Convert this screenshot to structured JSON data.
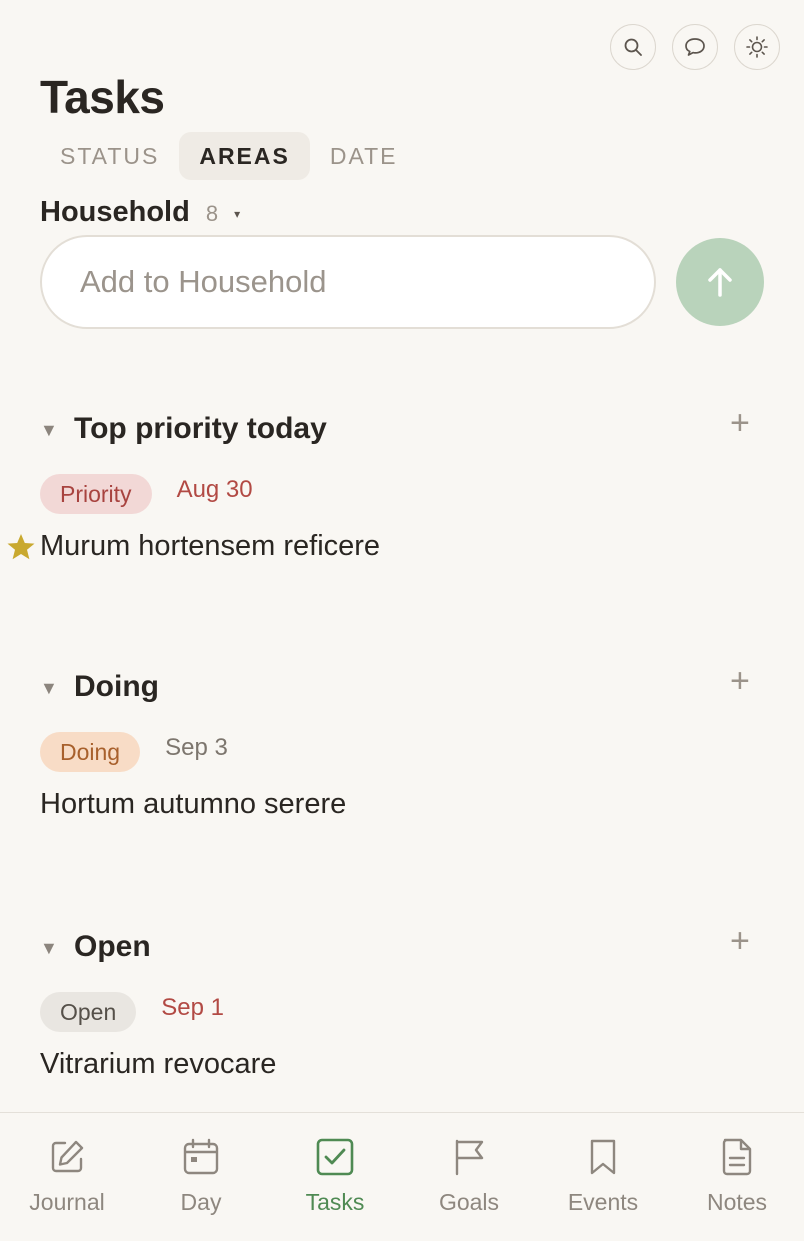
{
  "header": {
    "title": "Tasks",
    "icons": [
      "search-icon",
      "chat-icon",
      "brightness-icon"
    ]
  },
  "tabs": [
    {
      "label": "STATUS",
      "active": false
    },
    {
      "label": "AREAS",
      "active": true
    },
    {
      "label": "DATE",
      "active": false
    }
  ],
  "area": {
    "name": "Household",
    "count": "8",
    "caret": "▾"
  },
  "add_input": {
    "placeholder": "Add to Household",
    "value": ""
  },
  "sections": [
    {
      "title": "Top priority today",
      "caret": "▼",
      "add": "+",
      "task": {
        "badge": "Priority",
        "due": "Aug 30",
        "due_color": "#b24a44",
        "title": "Murum hortensem reficere",
        "starred": true
      }
    },
    {
      "title": "Doing",
      "caret": "▼",
      "add": "+",
      "task": {
        "badge": "Doing",
        "due": "Sep 3",
        "due_color": "#7d766e",
        "title": "Hortum autumno serere",
        "starred": false
      }
    },
    {
      "title": "Open",
      "caret": "▼",
      "add": "+",
      "task": {
        "badge": "Open",
        "due": "Sep 1",
        "due_color": "#b24a44",
        "title": "Vitrarium revocare",
        "starred": false
      }
    }
  ],
  "bottom_nav": [
    {
      "label": "Journal",
      "icon": "edit-icon",
      "active": false
    },
    {
      "label": "Day",
      "icon": "calendar-icon",
      "active": false
    },
    {
      "label": "Tasks",
      "icon": "checkbox-icon",
      "active": true
    },
    {
      "label": "Goals",
      "icon": "flag-icon",
      "active": false
    },
    {
      "label": "Events",
      "icon": "bookmark-icon",
      "active": false
    },
    {
      "label": "Notes",
      "icon": "document-icon",
      "active": false
    }
  ],
  "colors": {
    "background": "#f9f7f3",
    "accent_green": "#4f8a53",
    "send_button": "#b9d3bb",
    "star": "#c9a92f"
  }
}
